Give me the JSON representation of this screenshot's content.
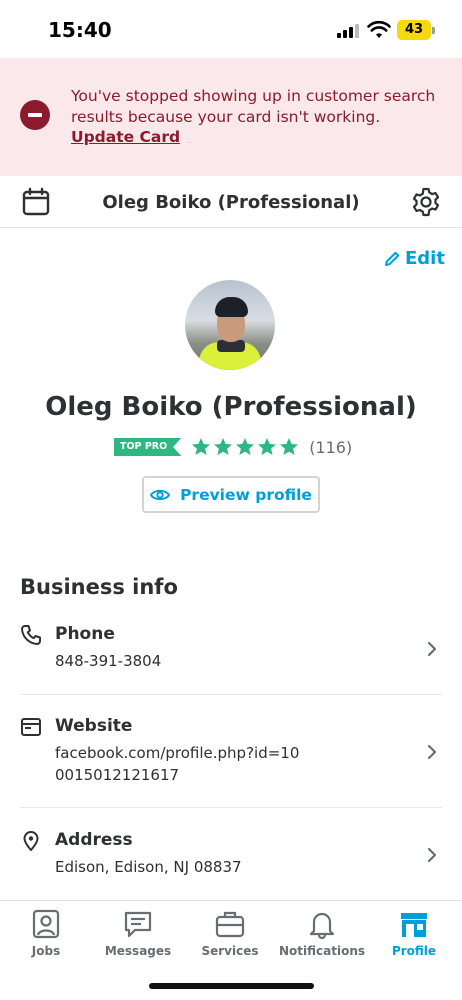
{
  "status_bar": {
    "time": "15:40",
    "battery": "43"
  },
  "alert": {
    "message": "You've stopped showing up in customer search results because your card isn't working.",
    "link_label": "Update Card"
  },
  "header": {
    "title": "Oleg Boiko (Professional)"
  },
  "profile": {
    "edit_label": "Edit",
    "name": "Oleg Boiko (Professional)",
    "badge": "TOP PRO",
    "rating_stars": 5,
    "review_count": "(116)",
    "preview_label": "Preview profile"
  },
  "business_info": {
    "title": "Business info",
    "items": [
      {
        "label": "Phone",
        "value": "848-391-3804",
        "icon": "phone-icon"
      },
      {
        "label": "Website",
        "value": "facebook.com/profile.php?id=100015012121617",
        "icon": "browser-window-icon"
      },
      {
        "label": "Address",
        "value": "Edison, Edison, NJ 08837",
        "icon": "map-pin-icon"
      }
    ]
  },
  "nav": {
    "items": [
      {
        "label": "Jobs",
        "icon": "jobs-icon"
      },
      {
        "label": "Messages",
        "icon": "messages-icon"
      },
      {
        "label": "Services",
        "icon": "briefcase-icon"
      },
      {
        "label": "Notifications",
        "icon": "bell-icon"
      },
      {
        "label": "Profile",
        "icon": "storefront-icon"
      }
    ],
    "active": "Profile"
  },
  "colors": {
    "accent": "#009fd9",
    "alert_bg": "#fbe8ea",
    "alert_text": "#8c1b2d",
    "star_green": "#2db783"
  }
}
